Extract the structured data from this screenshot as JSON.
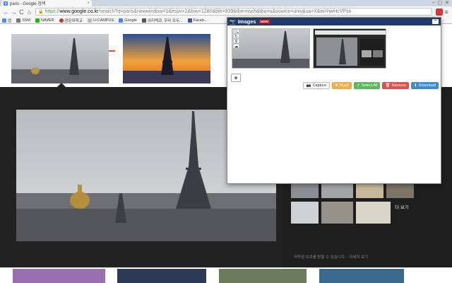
{
  "browser": {
    "tab_title": "paris - Google 검색",
    "tab_close": "×",
    "favicon_letter": "g",
    "win_controls": [
      "⎯",
      "▢",
      "✕"
    ],
    "nav": {
      "back": "←",
      "forward": "→",
      "reload": "C",
      "home": "⌂"
    },
    "url": {
      "scheme": "https://",
      "host": "www.google.co.kr",
      "path": "/search?q=paris&newwindow=1&espv=2&biw=1280&bih=939&tbm=isch&tbo=u&source=univ&sa=X&ei=hwHcVPsn"
    },
    "menu_icon": "≡"
  },
  "bookmarks": [
    {
      "label": "앱",
      "color": "#4a8af4"
    },
    {
      "label": "SSM",
      "color": "#777777"
    },
    {
      "label": "NAVER",
      "color": "#2db400"
    },
    {
      "label": "광운대학교",
      "color": "#c0392b"
    },
    {
      "label": "U-CAMPUS",
      "color": "#888888"
    },
    {
      "label": "Google",
      "color": "#4285f4"
    },
    {
      "label": "위키백과, 우리 모두...",
      "color": "#555555"
    },
    {
      "label": "Faceb...",
      "color": "#3b5998"
    }
  ],
  "results": {
    "related_more": "더 보기",
    "caption": "저작권 보호를 받을 수 있습니다. - 자세히 보기"
  },
  "popup": {
    "title": "Images",
    "badge": "NOW",
    "minimize": "−",
    "tools": [
      "🔍",
      "↻",
      "⚲",
      "☁"
    ],
    "add_label": "+",
    "actions": {
      "capture": "Capture",
      "flush": "Flush",
      "select_all": "Select All",
      "remove": "Remove",
      "download": "Download"
    },
    "action_icons": {
      "capture": "📷",
      "flush": "✖",
      "select_all": "✔",
      "remove": "🗑",
      "download": "⬇"
    }
  },
  "colors": {
    "popup_header": "#1f3a6b",
    "flush": "#f0ad4e",
    "select_all": "#5cb85c",
    "remove": "#d9534f",
    "download": "#428bca",
    "google_red": "#dd4b39"
  }
}
